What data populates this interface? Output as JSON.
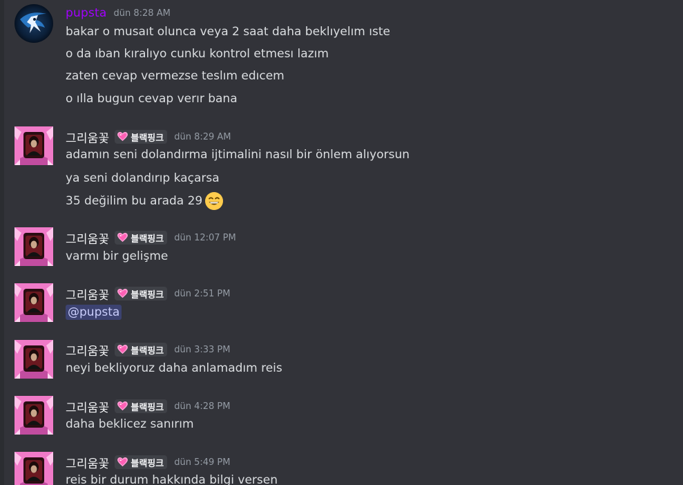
{
  "messages": [
    {
      "author": "pupsta",
      "time": "dün 8:28 AM",
      "lines": [
        "bakar o musaıt olunca veya 2 saat daha beklıyelım ıste",
        "o da ıban kıralıyo cunku kontrol etmesı lazım",
        "zaten cevap vermezse teslım edıcem",
        "o ılla bugun cevap verır bana"
      ]
    },
    {
      "author": "그리움꽃",
      "badge": "블랙핑크",
      "time": "dün 8:29 AM",
      "lines": [
        "adamın seni dolandırma ijtimalini nasıl bir önlem alıyorsun",
        "ya seni dolandırıp kaçarsa",
        "35 değilim bu arada 29"
      ],
      "emoji": "grinning-face-emoji"
    },
    {
      "author": "그리움꽃",
      "badge": "블랙핑크",
      "time": "dün 12:07 PM",
      "lines": [
        "varmı bir gelişme"
      ]
    },
    {
      "author": "그리움꽃",
      "badge": "블랙핑크",
      "time": "dün 2:51 PM",
      "mention": "@pupsta"
    },
    {
      "author": "그리움꽃",
      "badge": "블랙핑크",
      "time": "dün 3:33 PM",
      "lines": [
        "neyi bekliyoruz daha anlamadım reis"
      ]
    },
    {
      "author": "그리움꽃",
      "badge": "블랙핑크",
      "time": "dün 4:28 PM",
      "lines": [
        "daha beklicez sanırım"
      ]
    },
    {
      "author": "그리움꽃",
      "badge": "블랙핑크",
      "time": "dün 5:49 PM",
      "lines": [
        "reis bir durum hakkında bilgi versen"
      ]
    }
  ],
  "colors": {
    "background": "#323339",
    "pupsta_name": "#a200ff",
    "mention_bg": "#3c4270",
    "mention_text": "#c9cdfb",
    "badge_bg": "#3f4147",
    "timestamp": "#949ba4"
  },
  "icons": {
    "pupsta_avatar": "dark-blue-swirl-avatar",
    "other_avatar": "pink-framed-portrait-avatar",
    "badge_icon": "pink-heart-icon"
  }
}
